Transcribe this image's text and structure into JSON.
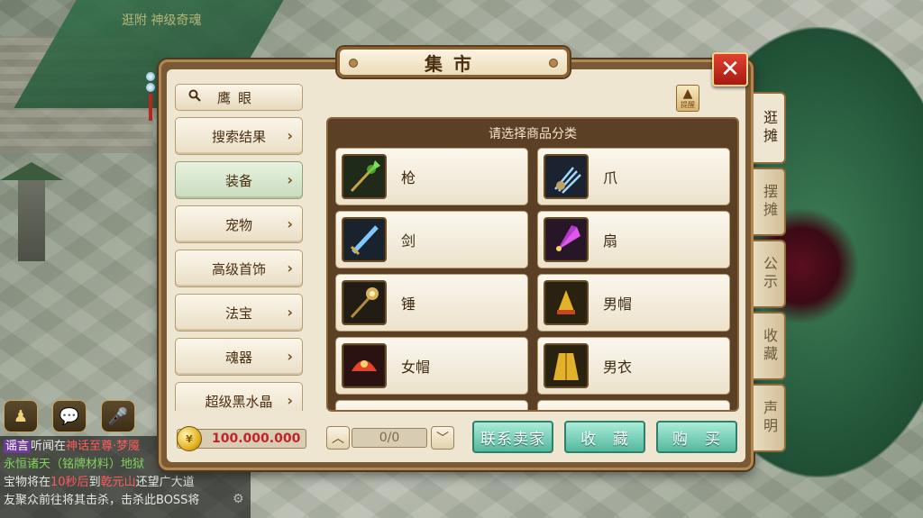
{
  "background": {
    "top_title": "逛附 神级奇魂"
  },
  "panel": {
    "title": "集市",
    "close_label": "✕"
  },
  "search": {
    "label": "鹰眼"
  },
  "menu": {
    "items": [
      {
        "label": "搜索结果",
        "active": false
      },
      {
        "label": "装备",
        "active": true
      },
      {
        "label": "宠物",
        "active": false
      },
      {
        "label": "高级首饰",
        "active": false
      },
      {
        "label": "法宝",
        "active": false
      },
      {
        "label": "魂器",
        "active": false
      },
      {
        "label": "超级黑水晶",
        "active": false
      }
    ]
  },
  "tip": {
    "label": "提醒"
  },
  "content": {
    "header": "请选择商品分类",
    "categories": [
      {
        "label": "枪",
        "icon": "spear-icon"
      },
      {
        "label": "爪",
        "icon": "claw-icon"
      },
      {
        "label": "剑",
        "icon": "sword-icon"
      },
      {
        "label": "扇",
        "icon": "fan-icon"
      },
      {
        "label": "锤",
        "icon": "hammer-icon"
      },
      {
        "label": "男帽",
        "icon": "male-hat-icon"
      },
      {
        "label": "女帽",
        "icon": "female-hat-icon"
      },
      {
        "label": "男衣",
        "icon": "male-clothes-icon"
      }
    ]
  },
  "footer": {
    "money": "100.000.000",
    "page": "0/0",
    "contact_seller": "联系卖家",
    "favorite": "收　藏",
    "buy": "购　买"
  },
  "tabs": [
    {
      "label": "逛摊",
      "active": true
    },
    {
      "label": "摆摊",
      "active": false
    },
    {
      "label": "公示",
      "active": false
    },
    {
      "label": "收藏",
      "active": false
    },
    {
      "label": "声明",
      "active": false
    }
  ],
  "chat": {
    "lines": [
      {
        "tag": "谣言",
        "text": "听闻在",
        "highlight": "神话至尊·梦魇"
      },
      {
        "tag": "",
        "text": "永恒诸天（铭牌材料）地狱",
        "highlight": ""
      },
      {
        "tag": "",
        "text": "宝物将在",
        "highlight": "10秒后",
        "text2": "到",
        "highlight2": "乾元山",
        "text3": "还望广大道"
      },
      {
        "tag": "",
        "text": "友聚众前往将其击杀，击杀此BOSS将",
        "highlight": ""
      }
    ]
  },
  "colors": {
    "panel_border": "#7a5a35",
    "panel_bg": "#efe6d1",
    "action_button": "#54b89e",
    "money_text": "#c0242a",
    "close_button": "#e0412e"
  }
}
